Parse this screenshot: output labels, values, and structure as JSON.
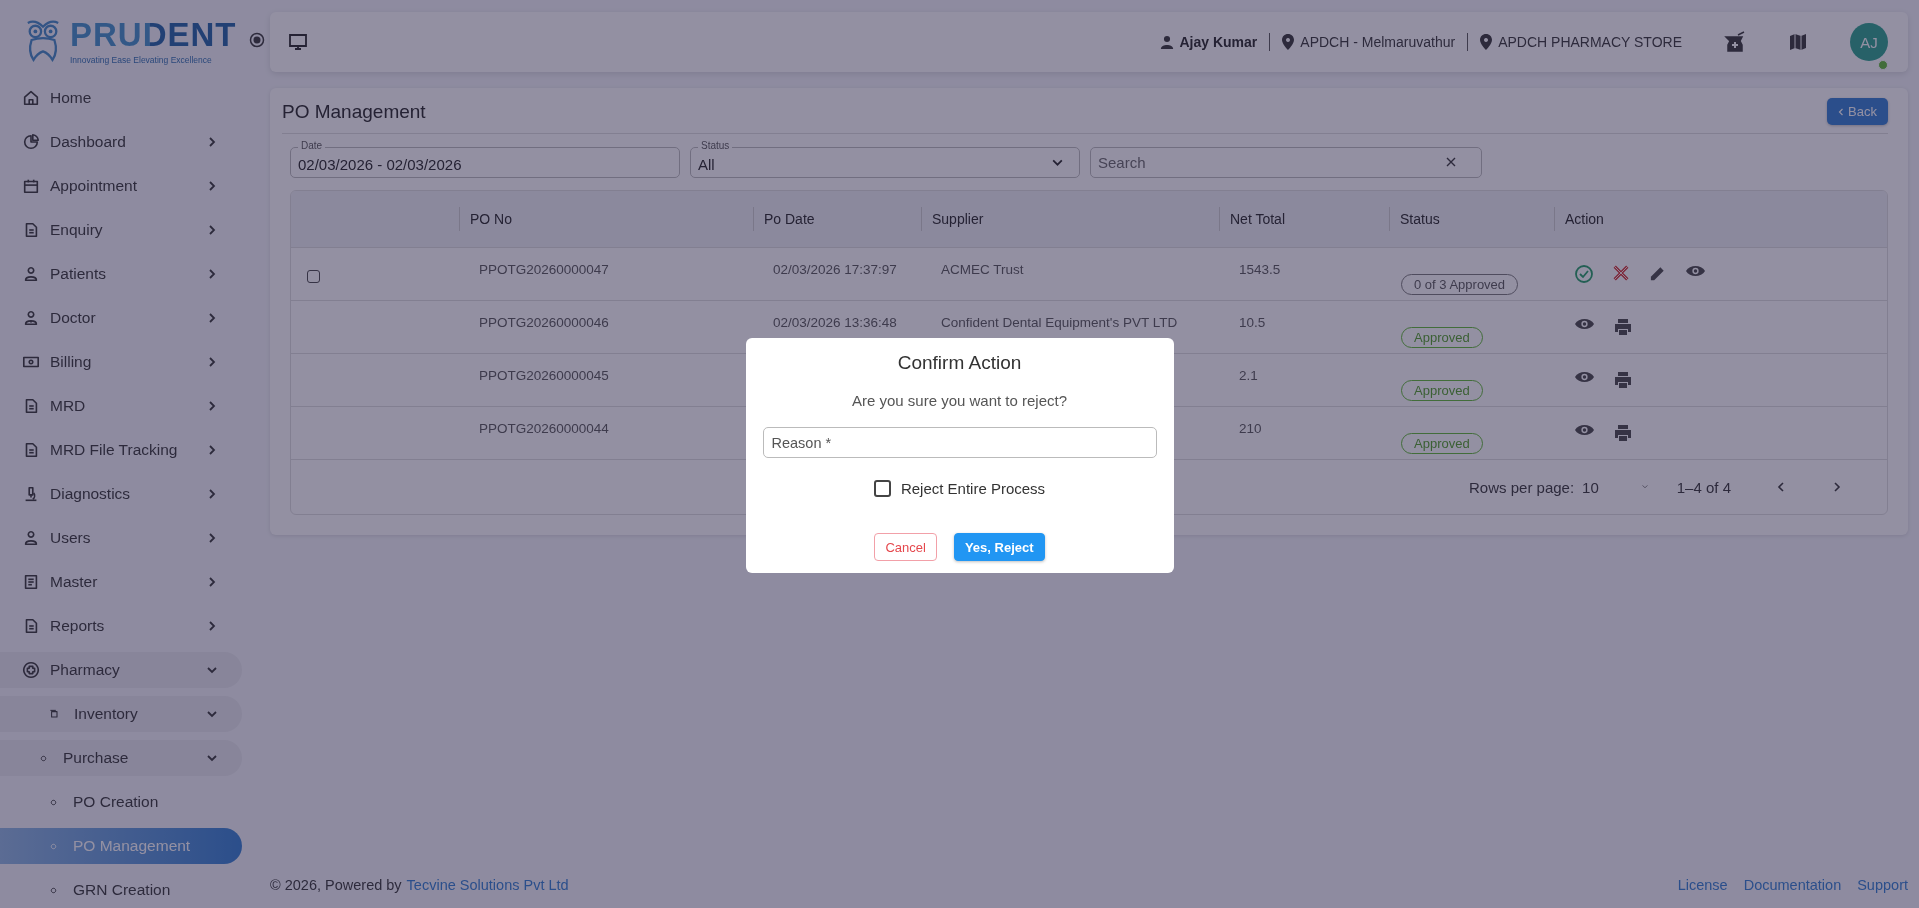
{
  "sidebar": {
    "logo": {
      "name": "PRUDENT",
      "tagline": "Innovating Ease Elevating Excellence"
    },
    "items": [
      {
        "label": "Home",
        "kind": "link",
        "selected": false
      },
      {
        "label": "Dashboard",
        "kind": "group",
        "expanded": false,
        "selected": false
      },
      {
        "label": "Appointment",
        "kind": "group",
        "expanded": false,
        "selected": false
      },
      {
        "label": "Enquiry",
        "kind": "group",
        "expanded": false,
        "selected": false
      },
      {
        "label": "Patients",
        "kind": "group",
        "expanded": false,
        "selected": false
      },
      {
        "label": "Doctor",
        "kind": "group",
        "expanded": false,
        "selected": false
      },
      {
        "label": "Billing",
        "kind": "group",
        "expanded": false,
        "selected": false
      },
      {
        "label": "MRD",
        "kind": "group",
        "expanded": false,
        "selected": false
      },
      {
        "label": "MRD File Tracking",
        "kind": "group",
        "expanded": false,
        "selected": false
      },
      {
        "label": "Diagnostics",
        "kind": "group",
        "expanded": false,
        "selected": false
      },
      {
        "label": "Users",
        "kind": "group",
        "expanded": false,
        "selected": false
      },
      {
        "label": "Master",
        "kind": "group",
        "expanded": false,
        "selected": false
      },
      {
        "label": "Reports",
        "kind": "group",
        "expanded": false,
        "selected": false
      },
      {
        "label": "Pharmacy",
        "kind": "group",
        "expanded": true,
        "selected": false,
        "children": [
          {
            "label": "Inventory",
            "kind": "group",
            "expanded": true,
            "selected": false,
            "children": [
              {
                "label": "Purchase",
                "kind": "group",
                "expanded": true,
                "selected": false,
                "children": [
                  {
                    "label": "PO Creation",
                    "kind": "link",
                    "selected": false
                  },
                  {
                    "label": "PO Management",
                    "kind": "link",
                    "selected": true
                  },
                  {
                    "label": "GRN Creation",
                    "kind": "link",
                    "selected": false
                  }
                ]
              }
            ]
          }
        ]
      }
    ]
  },
  "header": {
    "user": "Ajay Kumar",
    "location": "APDCH - Melmaruvathur",
    "store": "APDCH PHARMACY STORE",
    "avatar": {
      "initials": "AJ",
      "online": true
    }
  },
  "page": {
    "title": "PO Management",
    "back_button": "Back",
    "filters": {
      "date": {
        "label": "Date",
        "value": "02/03/2026 - 02/03/2026"
      },
      "status": {
        "label": "Status",
        "value": "All"
      },
      "search": {
        "placeholder": "Search"
      }
    },
    "table": {
      "columns": [
        "PO No",
        "Po Date",
        "Supplier",
        "Net Total",
        "Status",
        "Action"
      ],
      "rows": [
        {
          "checkbox": {
            "checked": false
          },
          "po_no": "PPOTG20260000047",
          "po_date": "02/03/2026 17:37:97",
          "supplier": "ACMEC Trust",
          "net_total": "1543.5",
          "status": {
            "text": "0 of 3 Approved",
            "kind": "pending"
          },
          "actions": [
            {
              "kind": "approve"
            },
            {
              "kind": "reject"
            },
            {
              "kind": "edit"
            },
            {
              "kind": "view"
            }
          ]
        },
        {
          "po_no": "PPOTG20260000046",
          "po_date": "02/03/2026 13:36:48",
          "supplier": "Confident Dental Equipment's PVT LTD",
          "net_total": "10.5",
          "status": {
            "text": "Approved",
            "kind": "approved"
          },
          "actions": [
            {
              "kind": "view"
            },
            {
              "kind": "print"
            }
          ]
        },
        {
          "po_no": "PPOTG20260000045",
          "po_date": "",
          "supplier": "",
          "net_total": "2.1",
          "status": {
            "text": "Approved",
            "kind": "approved"
          },
          "actions": [
            {
              "kind": "view"
            },
            {
              "kind": "print"
            }
          ]
        },
        {
          "po_no": "PPOTG20260000044",
          "po_date": "",
          "supplier": "",
          "net_total": "210",
          "status": {
            "text": "Approved",
            "kind": "approved"
          },
          "actions": [
            {
              "kind": "view"
            },
            {
              "kind": "print"
            }
          ]
        }
      ],
      "pagination": {
        "rows_per_page_label": "Rows per page:",
        "rows_per_page": "10",
        "range": "1–4 of 4"
      }
    }
  },
  "dialog": {
    "title": "Confirm Action",
    "message": "Are you sure you want to reject?",
    "reason": {
      "placeholder": "Reason *"
    },
    "reject_entire": {
      "label": "Reject Entire Process",
      "checked": false
    },
    "buttons": [
      {
        "label": "Cancel",
        "kind": "cancel"
      },
      {
        "label": "Yes, Reject",
        "kind": "confirm"
      }
    ]
  },
  "footer": {
    "copyright": "© 2026, Powered by",
    "company": "Tecvine Solutions Pvt Ltd",
    "links": [
      "License",
      "Documentation",
      "Support"
    ]
  }
}
